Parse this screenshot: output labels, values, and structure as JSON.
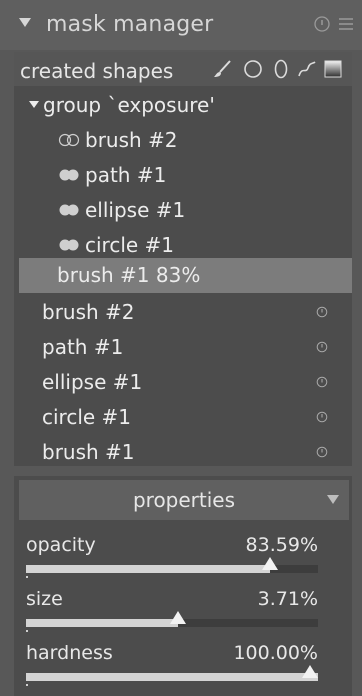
{
  "header": {
    "title": "mask manager",
    "icons": [
      "reset-icon",
      "presets-icon"
    ]
  },
  "toolbar": {
    "label": "created shapes",
    "tools": [
      "brush-icon",
      "circle-icon",
      "ellipse-icon",
      "path-icon",
      "gradient-icon"
    ]
  },
  "group": {
    "label": "group `exposure'",
    "children": [
      {
        "label": "brush #2",
        "blend": "outline"
      },
      {
        "label": "path #1",
        "blend": "filled"
      },
      {
        "label": "ellipse #1",
        "blend": "filled"
      },
      {
        "label": "circle #1",
        "blend": "filled"
      }
    ],
    "selected": {
      "label": "brush #1 83%"
    }
  },
  "shapes": [
    {
      "label": "brush #2"
    },
    {
      "label": "path #1"
    },
    {
      "label": "ellipse #1"
    },
    {
      "label": "circle #1"
    },
    {
      "label": "brush #1"
    }
  ],
  "properties": {
    "title": "properties",
    "sliders": [
      {
        "label": "opacity",
        "value": "83.59%",
        "fraction": 0.8359
      },
      {
        "label": "size",
        "value": "3.71%",
        "fraction": 0.522
      },
      {
        "label": "hardness",
        "value": "100.00%",
        "fraction": 1.0
      }
    ]
  }
}
